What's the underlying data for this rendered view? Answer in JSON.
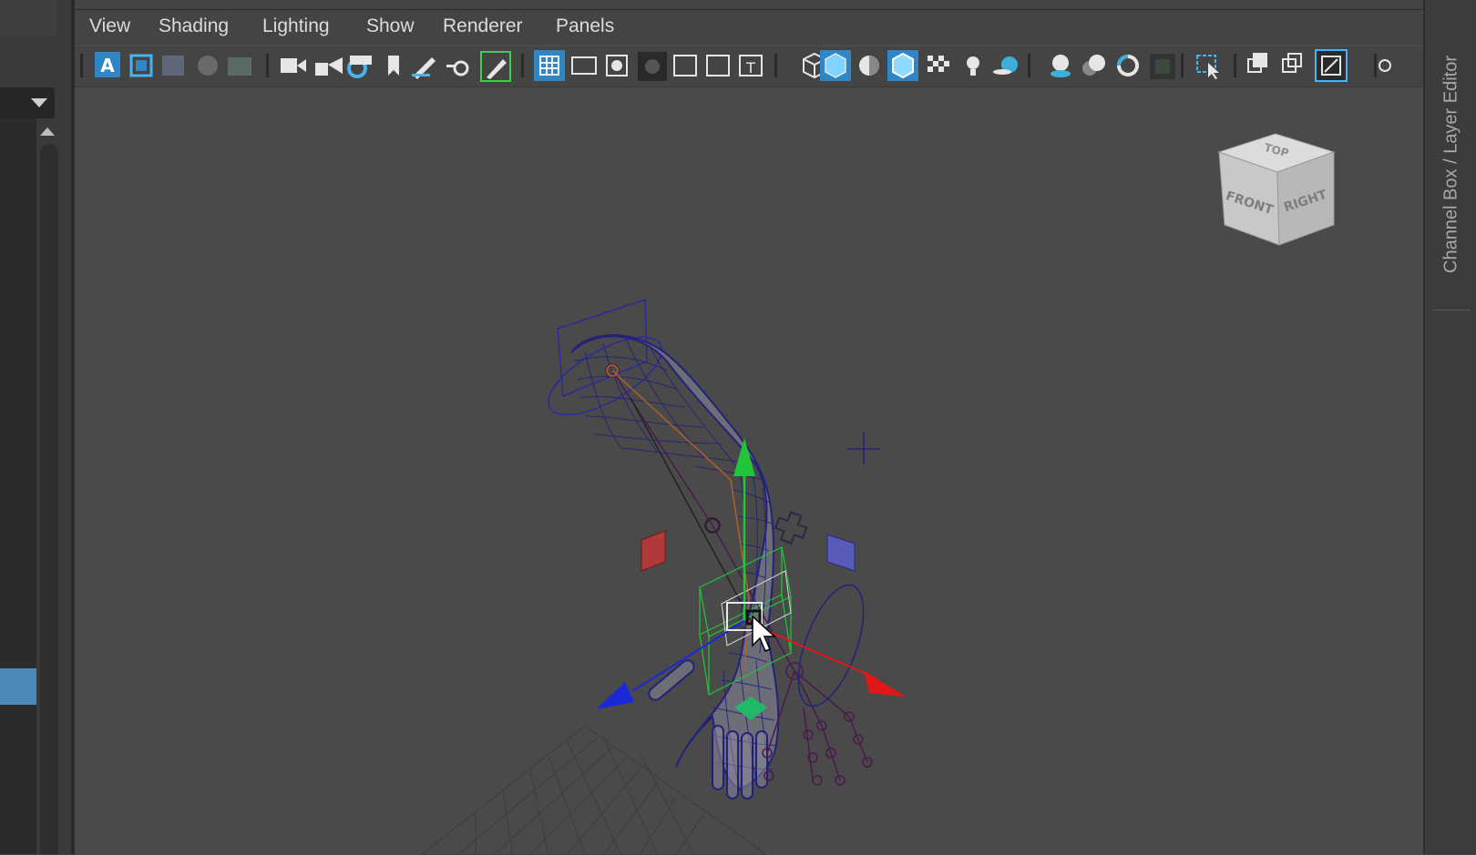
{
  "menu": {
    "items": [
      {
        "label": "View"
      },
      {
        "label": "Shading"
      },
      {
        "label": "Lighting"
      },
      {
        "label": "Show"
      },
      {
        "label": "Renderer"
      },
      {
        "label": "Panels"
      }
    ]
  },
  "toolbar": {
    "icons": [
      "select-camera-icon",
      "camera-attributes-icon",
      "bookmarks-icon",
      "image-plane-icon",
      "2d-pan-zoom-icon",
      "camera-icon",
      "lock-camera-icon",
      "camera-settings-icon",
      "bookmark-icon",
      "pencil-icon",
      "grease-pencil-icon",
      "grid-icon",
      "film-gate-icon",
      "resolution-gate-icon",
      "gate-mask-icon",
      "field-chart-icon",
      "safe-action-icon",
      "safe-title-icon",
      "wireframe-icon",
      "smooth-shade-icon",
      "default-material-icon",
      "wireframe-on-shaded-icon",
      "textured-icon",
      "lights-icon",
      "shadows-icon",
      "screen-space-ao-icon",
      "motion-blur-icon",
      "anti-aliasing-icon",
      "depth-of-field-icon",
      "isolate-select-icon",
      "xray-icon",
      "xray-joints-icon",
      "backface-culling-icon"
    ]
  },
  "viewcube": {
    "top_label": "TOP",
    "front_label": "FRONT",
    "right_label": "RIGHT"
  },
  "right_panel": {
    "tab_label": "Channel Box / Layer Editor"
  },
  "colors": {
    "viewport_bg": "#4a4a4a",
    "accent_blue": "#4a89b8",
    "wire_blue": "#2a2a8c",
    "gizmo_green": "#22c43a",
    "gizmo_red": "#e01818",
    "gizmo_blue": "#1a28d8",
    "joint_purple": "#4a1a4a"
  }
}
